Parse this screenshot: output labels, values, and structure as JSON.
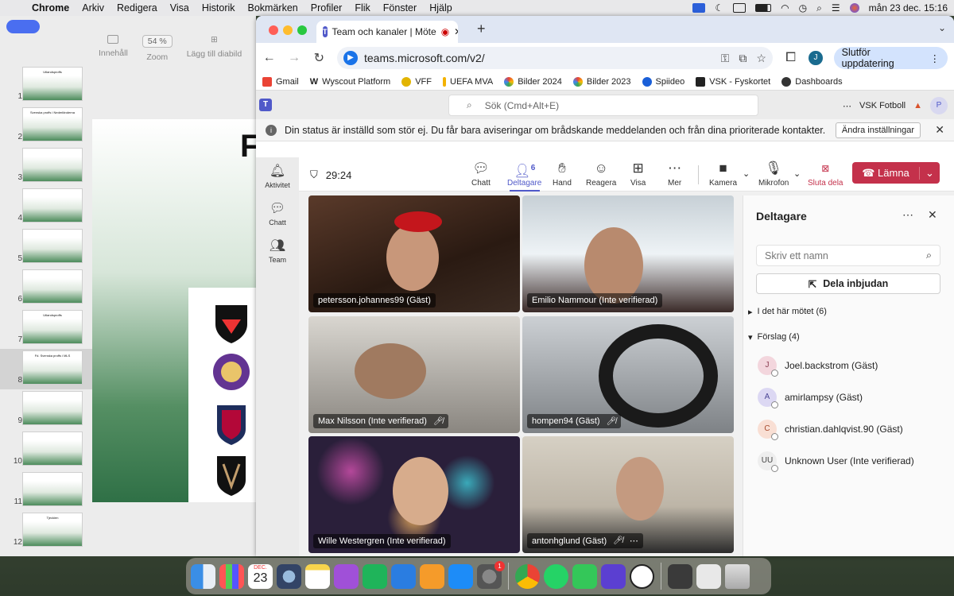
{
  "menubar": {
    "app": "Chrome",
    "items": [
      "Arkiv",
      "Redigera",
      "Visa",
      "Historik",
      "Bokmärken",
      "Profiler",
      "Flik",
      "Fönster",
      "Hjälp"
    ],
    "clock": "mån 23 dec. 15:16"
  },
  "keynote": {
    "toolbar": {
      "content_label": "Innehåll",
      "zoom_value": "54 %",
      "zoom_label": "Zoom",
      "add_slide_label": "Lägg till diabild"
    },
    "slides": [
      {
        "num": "1",
        "caption": "Utlandsproffs"
      },
      {
        "num": "2",
        "caption": "Svenska proffs i Nederländerna"
      },
      {
        "num": "3",
        "caption": ""
      },
      {
        "num": "4",
        "caption": ""
      },
      {
        "num": "5",
        "caption": ""
      },
      {
        "num": "6",
        "caption": ""
      },
      {
        "num": "7",
        "caption": "Utlandsproffs"
      },
      {
        "num": "8",
        "caption": "Fd. Svenska proffs i MLS"
      },
      {
        "num": "9",
        "caption": ""
      },
      {
        "num": "10",
        "caption": ""
      },
      {
        "num": "11",
        "caption": ""
      },
      {
        "num": "12",
        "caption": "Tjeckien"
      }
    ],
    "selected_slide": "8",
    "canvas_letter": "F"
  },
  "browser": {
    "tab_title": "Team och kanaler | Möte",
    "url": "teams.microsoft.com/v2/",
    "profile_initial": "J",
    "update_label": "Slutför uppdatering",
    "bookmarks": [
      "Gmail",
      "Wyscout Platform",
      "VFF",
      "UEFA MVA",
      "Bilder 2024",
      "Bilder 2023",
      "Spiideo",
      "VSK - Fyskortet",
      "Dashboards"
    ]
  },
  "teams": {
    "search_placeholder": "Sök (Cmd+Alt+E)",
    "org_name": "VSK Fotboll",
    "avatar_initial": "P",
    "banner_text": "Din status är inställd som stör ej. Du får bara aviseringar om brådskande meddelanden och från dina prioriterade kontakter.",
    "banner_button": "Ändra inställningar",
    "rail": [
      {
        "label": "Aktivitet"
      },
      {
        "label": "Chatt"
      },
      {
        "label": "Team"
      }
    ],
    "meeting": {
      "timer": "29:24",
      "participant_count": "6",
      "toolbar": {
        "chat": "Chatt",
        "participants": "Deltagare",
        "hand": "Hand",
        "react": "Reagera",
        "view": "Visa",
        "more": "Mer",
        "camera": "Kamera",
        "mic": "Mikrofon",
        "stop_share": "Sluta dela",
        "leave": "Lämna"
      },
      "tiles": [
        {
          "name": "petersson.johannes99 (Gäst)",
          "muted": false
        },
        {
          "name": "Emilio Nammour (Inte verifierad)",
          "muted": false
        },
        {
          "name": "Max Nilsson (Inte verifierad)",
          "muted": true
        },
        {
          "name": "hompen94 (Gäst)",
          "muted": true
        },
        {
          "name": "Wille Westergren (Inte verifierad)",
          "muted": false
        },
        {
          "name": "antonhglund (Gäst)",
          "muted": true
        }
      ]
    },
    "panel": {
      "title": "Deltagare",
      "search_placeholder": "Skriv ett namn",
      "invite_label": "Dela inbjudan",
      "in_meeting": "I det här mötet (6)",
      "suggestions": "Förslag (4)",
      "people": [
        {
          "initials": "J",
          "name": "Joel.backstrom (Gäst)"
        },
        {
          "initials": "A",
          "name": "amirlampsy (Gäst)"
        },
        {
          "initials": "C",
          "name": "christian.dahlqvist.90 (Gäst)"
        },
        {
          "initials": "UU",
          "name": "Unknown User (Inte verifierad)"
        }
      ]
    }
  },
  "dock": {
    "calendar_month": "DEC.",
    "calendar_day": "23",
    "badge": "1"
  }
}
